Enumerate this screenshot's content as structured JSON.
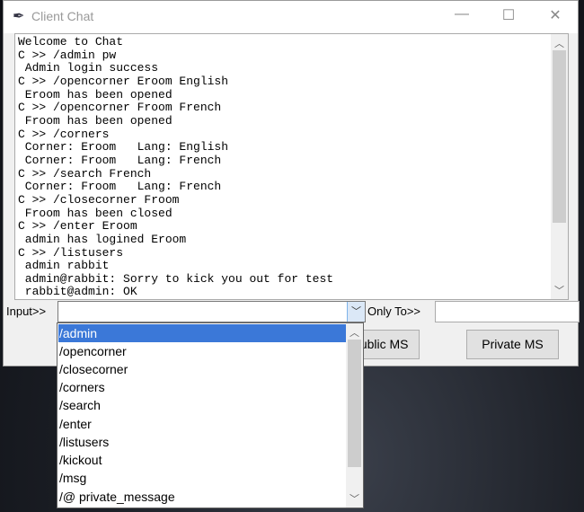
{
  "window": {
    "title": "Client Chat",
    "minimize": "—",
    "maximize": "☐",
    "close": "✕"
  },
  "chat_log": "Welcome to Chat\nC >> /admin pw\n Admin login success\nC >> /opencorner Eroom English\n Eroom has been opened\nC >> /opencorner Froom French\n Froom has been opened\nC >> /corners\n Corner: Eroom   Lang: English\n Corner: Froom   Lang: French\nC >> /search French\n Corner: Froom   Lang: French\nC >> /closecorner Froom\n Froom has been closed\nC >> /enter Eroom\n admin has logined Eroom\nC >> /listusers\n admin rabbit\n admin@rabbit: Sorry to kick you out for test\n rabbit@admin: OK",
  "input": {
    "label": "Input>>",
    "value": ""
  },
  "only_to": {
    "label": "Only To>>",
    "value": ""
  },
  "buttons": {
    "public": "Public MS",
    "private": "Private MS"
  },
  "dropdown": {
    "selected": "/admin",
    "options": [
      "/admin",
      "/opencorner",
      "/closecorner",
      "/corners",
      "/search",
      "/enter",
      "/listusers",
      "/kickout",
      "/msg",
      "/@ private_message"
    ]
  },
  "colors": {
    "selection": "#3b78d8"
  }
}
